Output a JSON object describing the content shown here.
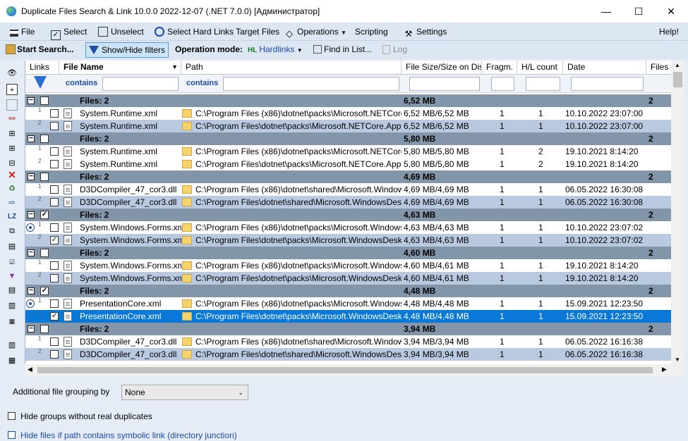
{
  "window": {
    "title": "Duplicate Files Search & Link 10.0.0 2022-12-07 (.NET 7.0.0) [Администратор]",
    "minimize": "—",
    "maximize": "☐",
    "close": "✕"
  },
  "menu": {
    "file": "File",
    "select": "Select",
    "unselect": "Unselect",
    "select_hard_links": "Select Hard Links Target Files",
    "operations": "Operations",
    "scripting": "Scripting",
    "settings": "Settings",
    "help": "Help!"
  },
  "toolbar": {
    "start_search": "Start Search...",
    "show_hide_filters": "Show/Hide filters",
    "operation_mode_label": "Operation mode:",
    "operation_mode_value": "Hardlinks",
    "find_in_list": "Find in List...",
    "log": "Log"
  },
  "columns": {
    "links": "Links",
    "file_name": "File Name",
    "path": "Path",
    "size": "File Size/Size on Disk",
    "fragm": "Fragm.",
    "hl_count": "H/L count",
    "date": "Date",
    "files": "Files"
  },
  "filters": {
    "name_op": "contains",
    "path_op": "contains"
  },
  "rows": [
    {
      "type": "group",
      "label": "Files: 2",
      "size": "6,52 MB",
      "files": "2",
      "check": ""
    },
    {
      "type": "file",
      "bg": "wht",
      "link": "1",
      "name": "System.Runtime.xml",
      "path": "C:\\Program Files (x86)\\dotnet\\packs\\Microsoft.NETCore.A...",
      "size": "6,52 MB/6,52 MB",
      "fragm": "1",
      "hl": "1",
      "date": "10.10.2022 23:07:00",
      "check": ""
    },
    {
      "type": "file",
      "bg": "alt",
      "link": "2",
      "name": "System.Runtime.xml",
      "path": "C:\\Program Files\\dotnet\\packs\\Microsoft.NETCore.App.Re...",
      "size": "6,52 MB/6,52 MB",
      "fragm": "1",
      "hl": "1",
      "date": "10.10.2022 23:07:00",
      "check": ""
    },
    {
      "type": "group",
      "label": "Files: 2",
      "size": "5,80 MB",
      "files": "2",
      "check": ""
    },
    {
      "type": "file",
      "bg": "wht",
      "link": "1",
      "name": "System.Runtime.xml",
      "path": "C:\\Program Files (x86)\\dotnet\\packs\\Microsoft.NETCore.A...",
      "size": "5,80 MB/5,80 MB",
      "fragm": "1",
      "hl": "2",
      "date": "19.10.2021 8:14:20",
      "check": ""
    },
    {
      "type": "file",
      "bg": "wht",
      "link": "2",
      "name": "System.Runtime.xml",
      "path": "C:\\Program Files\\dotnet\\packs\\Microsoft.NETCore.App.Re...",
      "size": "5,80 MB/5,80 MB",
      "fragm": "1",
      "hl": "2",
      "date": "19.10.2021 8:14:20",
      "check": ""
    },
    {
      "type": "group",
      "label": "Files: 2",
      "size": "4,69 MB",
      "files": "2",
      "check": ""
    },
    {
      "type": "file",
      "bg": "wht",
      "link": "1",
      "name": "D3DCompiler_47_cor3.dll",
      "path": "C:\\Program Files (x86)\\dotnet\\shared\\Microsoft.WindowsDe...",
      "size": "4,69 MB/4,69 MB",
      "fragm": "1",
      "hl": "1",
      "date": "06.05.2022 16:30:08",
      "check": ""
    },
    {
      "type": "file",
      "bg": "alt",
      "link": "2",
      "name": "D3DCompiler_47_cor3.dll",
      "path": "C:\\Program Files\\dotnet\\shared\\Microsoft.WindowsDeskto...",
      "size": "4,69 MB/4,69 MB",
      "fragm": "1",
      "hl": "1",
      "date": "06.05.2022 16:30:08",
      "check": ""
    },
    {
      "type": "group",
      "label": "Files: 2",
      "size": "4,63 MB",
      "files": "2",
      "check": "✓"
    },
    {
      "type": "file",
      "bg": "wht",
      "link": "1",
      "radio": true,
      "name": "System.Windows.Forms.xml",
      "path": "C:\\Program Files (x86)\\dotnet\\packs\\Microsoft.WindowsDe...",
      "size": "4,63 MB/4,63 MB",
      "fragm": "1",
      "hl": "1",
      "date": "10.10.2022 23:07:02",
      "check": ""
    },
    {
      "type": "file",
      "bg": "alt",
      "link": "2",
      "name": "System.Windows.Forms.xml",
      "path": "C:\\Program Files\\dotnet\\packs\\Microsoft.WindowsDesktop...",
      "size": "4,63 MB/4,63 MB",
      "fragm": "1",
      "hl": "1",
      "date": "10.10.2022 23:07:02",
      "check": "✓"
    },
    {
      "type": "group",
      "label": "Files: 2",
      "size": "4,60 MB",
      "files": "2",
      "check": ""
    },
    {
      "type": "file",
      "bg": "wht",
      "link": "1",
      "name": "System.Windows.Forms.xml",
      "path": "C:\\Program Files (x86)\\dotnet\\packs\\Microsoft.WindowsDe...",
      "size": "4,60 MB/4,61 MB",
      "fragm": "1",
      "hl": "1",
      "date": "19.10.2021 8:14:20",
      "check": ""
    },
    {
      "type": "file",
      "bg": "alt",
      "link": "2",
      "name": "System.Windows.Forms.xml",
      "path": "C:\\Program Files\\dotnet\\packs\\Microsoft.WindowsDesktop...",
      "size": "4,60 MB/4,61 MB",
      "fragm": "1",
      "hl": "1",
      "date": "19.10.2021 8:14:20",
      "check": ""
    },
    {
      "type": "group",
      "label": "Files: 2",
      "size": "4,48 MB",
      "files": "2",
      "check": "✓"
    },
    {
      "type": "file",
      "bg": "wht",
      "link": "1",
      "radio": true,
      "name": "PresentationCore.xml",
      "path": "C:\\Program Files (x86)\\dotnet\\packs\\Microsoft.WindowsDe...",
      "size": "4,48 MB/4,48 MB",
      "fragm": "1",
      "hl": "1",
      "date": "15.09.2021 12:23:50",
      "check": ""
    },
    {
      "type": "file",
      "bg": "sel",
      "link": "2",
      "name": "PresentationCore.xml",
      "path": "C:\\Program Files\\dotnet\\packs\\Microsoft.WindowsDesktop...",
      "size": "4,48 MB/4,48 MB",
      "fragm": "1",
      "hl": "1",
      "date": "15.09.2021 12:23:50",
      "check": "✓"
    },
    {
      "type": "group",
      "label": "Files: 2",
      "size": "3,94 MB",
      "files": "2",
      "check": ""
    },
    {
      "type": "file",
      "bg": "wht",
      "link": "1",
      "name": "D3DCompiler_47_cor3.dll",
      "path": "C:\\Program Files (x86)\\dotnet\\shared\\Microsoft.WindowsD...",
      "size": "3,94 MB/3,94 MB",
      "fragm": "1",
      "hl": "1",
      "date": "06.05.2022 16:16:38",
      "check": ""
    },
    {
      "type": "file",
      "bg": "alt",
      "link": "2",
      "name": "D3DCompiler_47_cor3.dll",
      "path": "C:\\Program Files\\dotnet\\shared\\Microsoft.WindowsDeskto...",
      "size": "3,94 MB/3,94 MB",
      "fragm": "1",
      "hl": "1",
      "date": "06.05.2022 16:16:38",
      "check": ""
    }
  ],
  "bottom": {
    "grouping_label": "Additional file grouping by",
    "grouping_value": "None",
    "hide_groups": "Hide groups without real duplicates",
    "hide_symlink": "Hide files if path contains symbolic link (directory junction)"
  }
}
